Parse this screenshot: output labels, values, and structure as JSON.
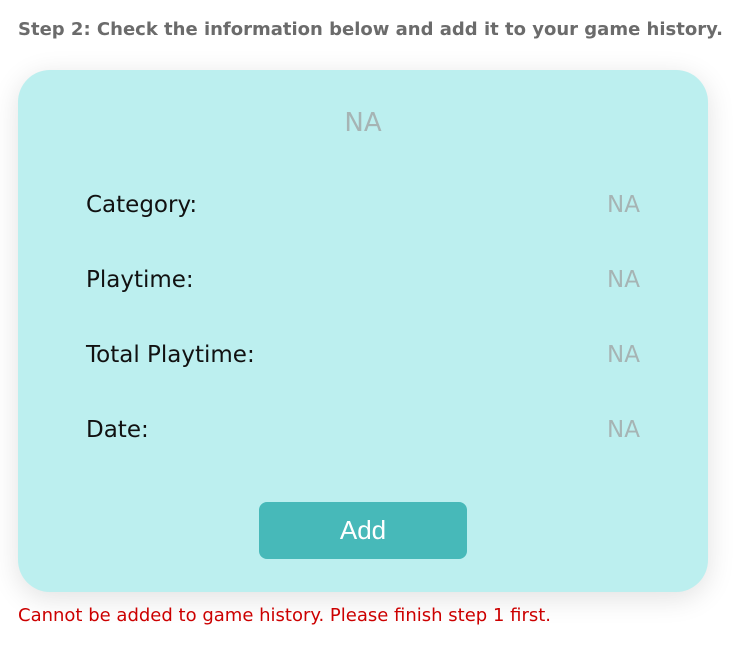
{
  "step": {
    "title": "Step 2: Check the information below and add it to your game history."
  },
  "card": {
    "game_name": "NA",
    "rows": [
      {
        "label": "Category:",
        "value": "NA"
      },
      {
        "label": "Playtime:",
        "value": "NA"
      },
      {
        "label": "Total Playtime:",
        "value": "NA"
      },
      {
        "label": "Date:",
        "value": "NA"
      }
    ],
    "add_label": "Add"
  },
  "error": {
    "message": "Cannot be added to game history. Please finish step 1 first."
  },
  "colors": {
    "card_background": "#bcefef",
    "button": "#47b9b9",
    "placeholder_text": "#a6b4b4",
    "error_text": "#cc0000"
  }
}
